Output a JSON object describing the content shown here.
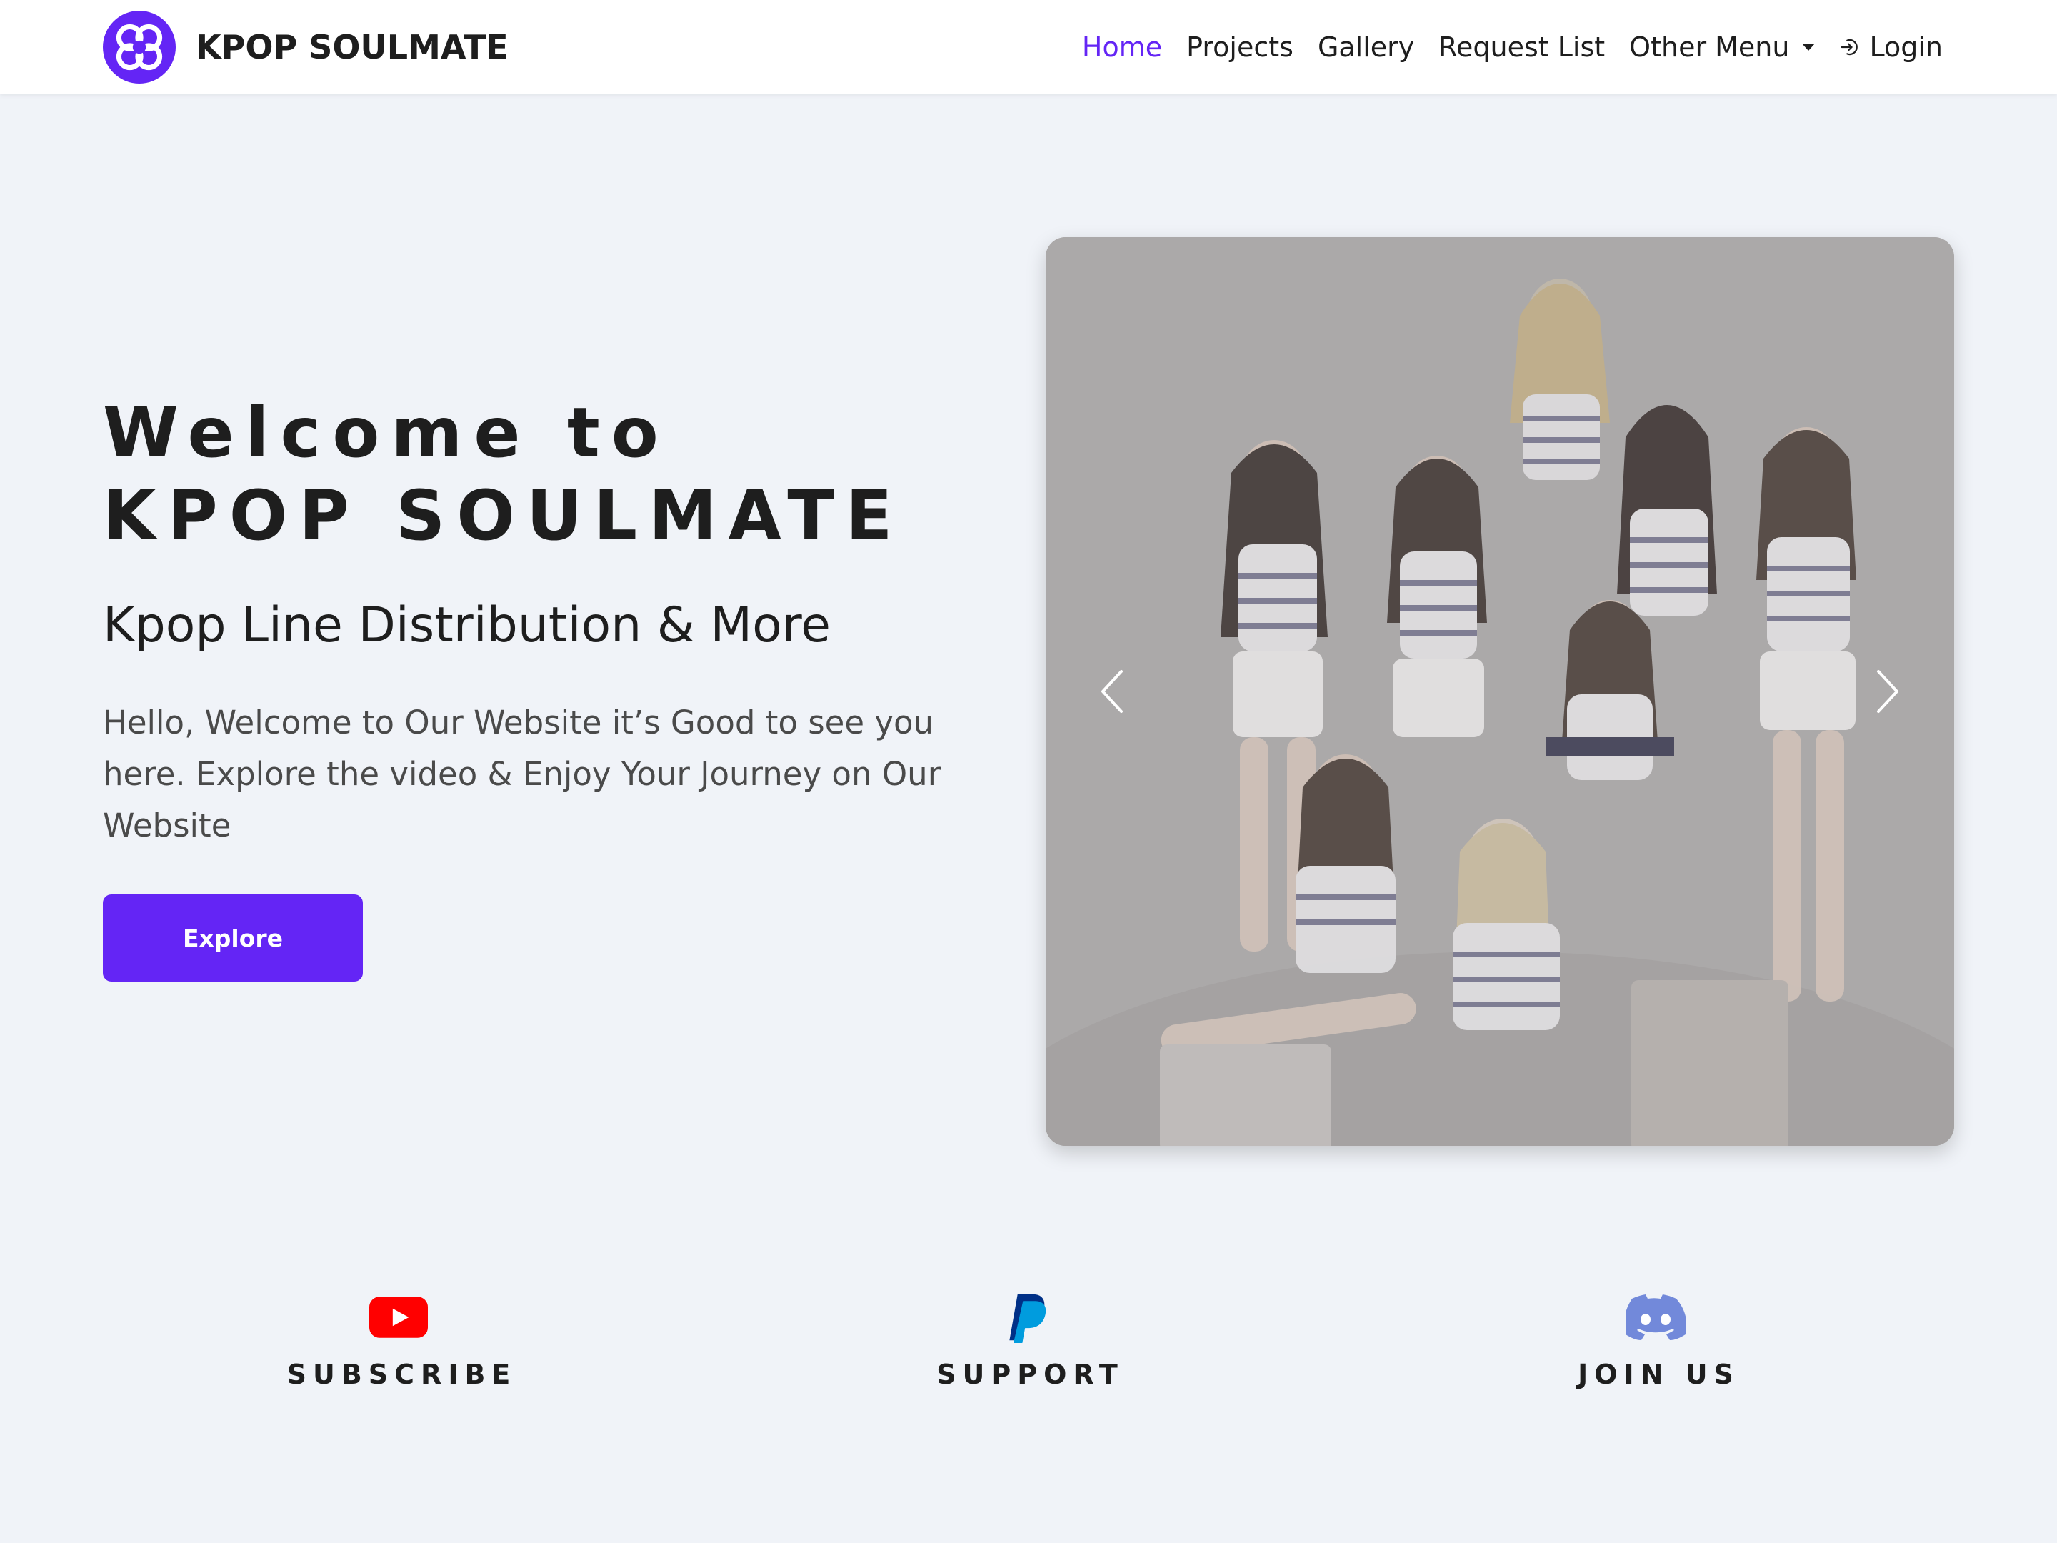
{
  "brand": {
    "name": "KPOP SOULMATE",
    "logo_icon": "butterfly-logo-icon",
    "brand_color": "#6425f5"
  },
  "nav": {
    "items": [
      {
        "label": "Home",
        "active": true
      },
      {
        "label": "Projects",
        "active": false
      },
      {
        "label": "Gallery",
        "active": false
      },
      {
        "label": "Request List",
        "active": false
      },
      {
        "label": "Other Menu",
        "active": false,
        "has_dropdown": true
      }
    ],
    "login": {
      "label": "Login",
      "icon": "login-icon"
    }
  },
  "hero": {
    "title_line1": "Welcome to",
    "title_line2": "KPOP SOULMATE",
    "subtitle": "Kpop Line Distribution & More",
    "text": "Hello, Welcome to Our Website it’s Good to see you here. Explore the video & Enjoy Your Journey on Our Website",
    "button_label": "Explore"
  },
  "carousel": {
    "prev_icon": "chevron-left-icon",
    "next_icon": "chevron-right-icon"
  },
  "social": [
    {
      "label": "SUBSCRIBE",
      "icon": "youtube-icon",
      "color": "#ff0000"
    },
    {
      "label": "SUPPORT",
      "icon": "paypal-icon",
      "color": "#009cde"
    },
    {
      "label": "JOIN US",
      "icon": "discord-icon",
      "color": "#7289da"
    }
  ],
  "colors": {
    "accent": "#6425f5",
    "page_background": "#f0f3f8",
    "text_dark": "#1e1e1e",
    "text_muted": "#4a4a4a"
  }
}
